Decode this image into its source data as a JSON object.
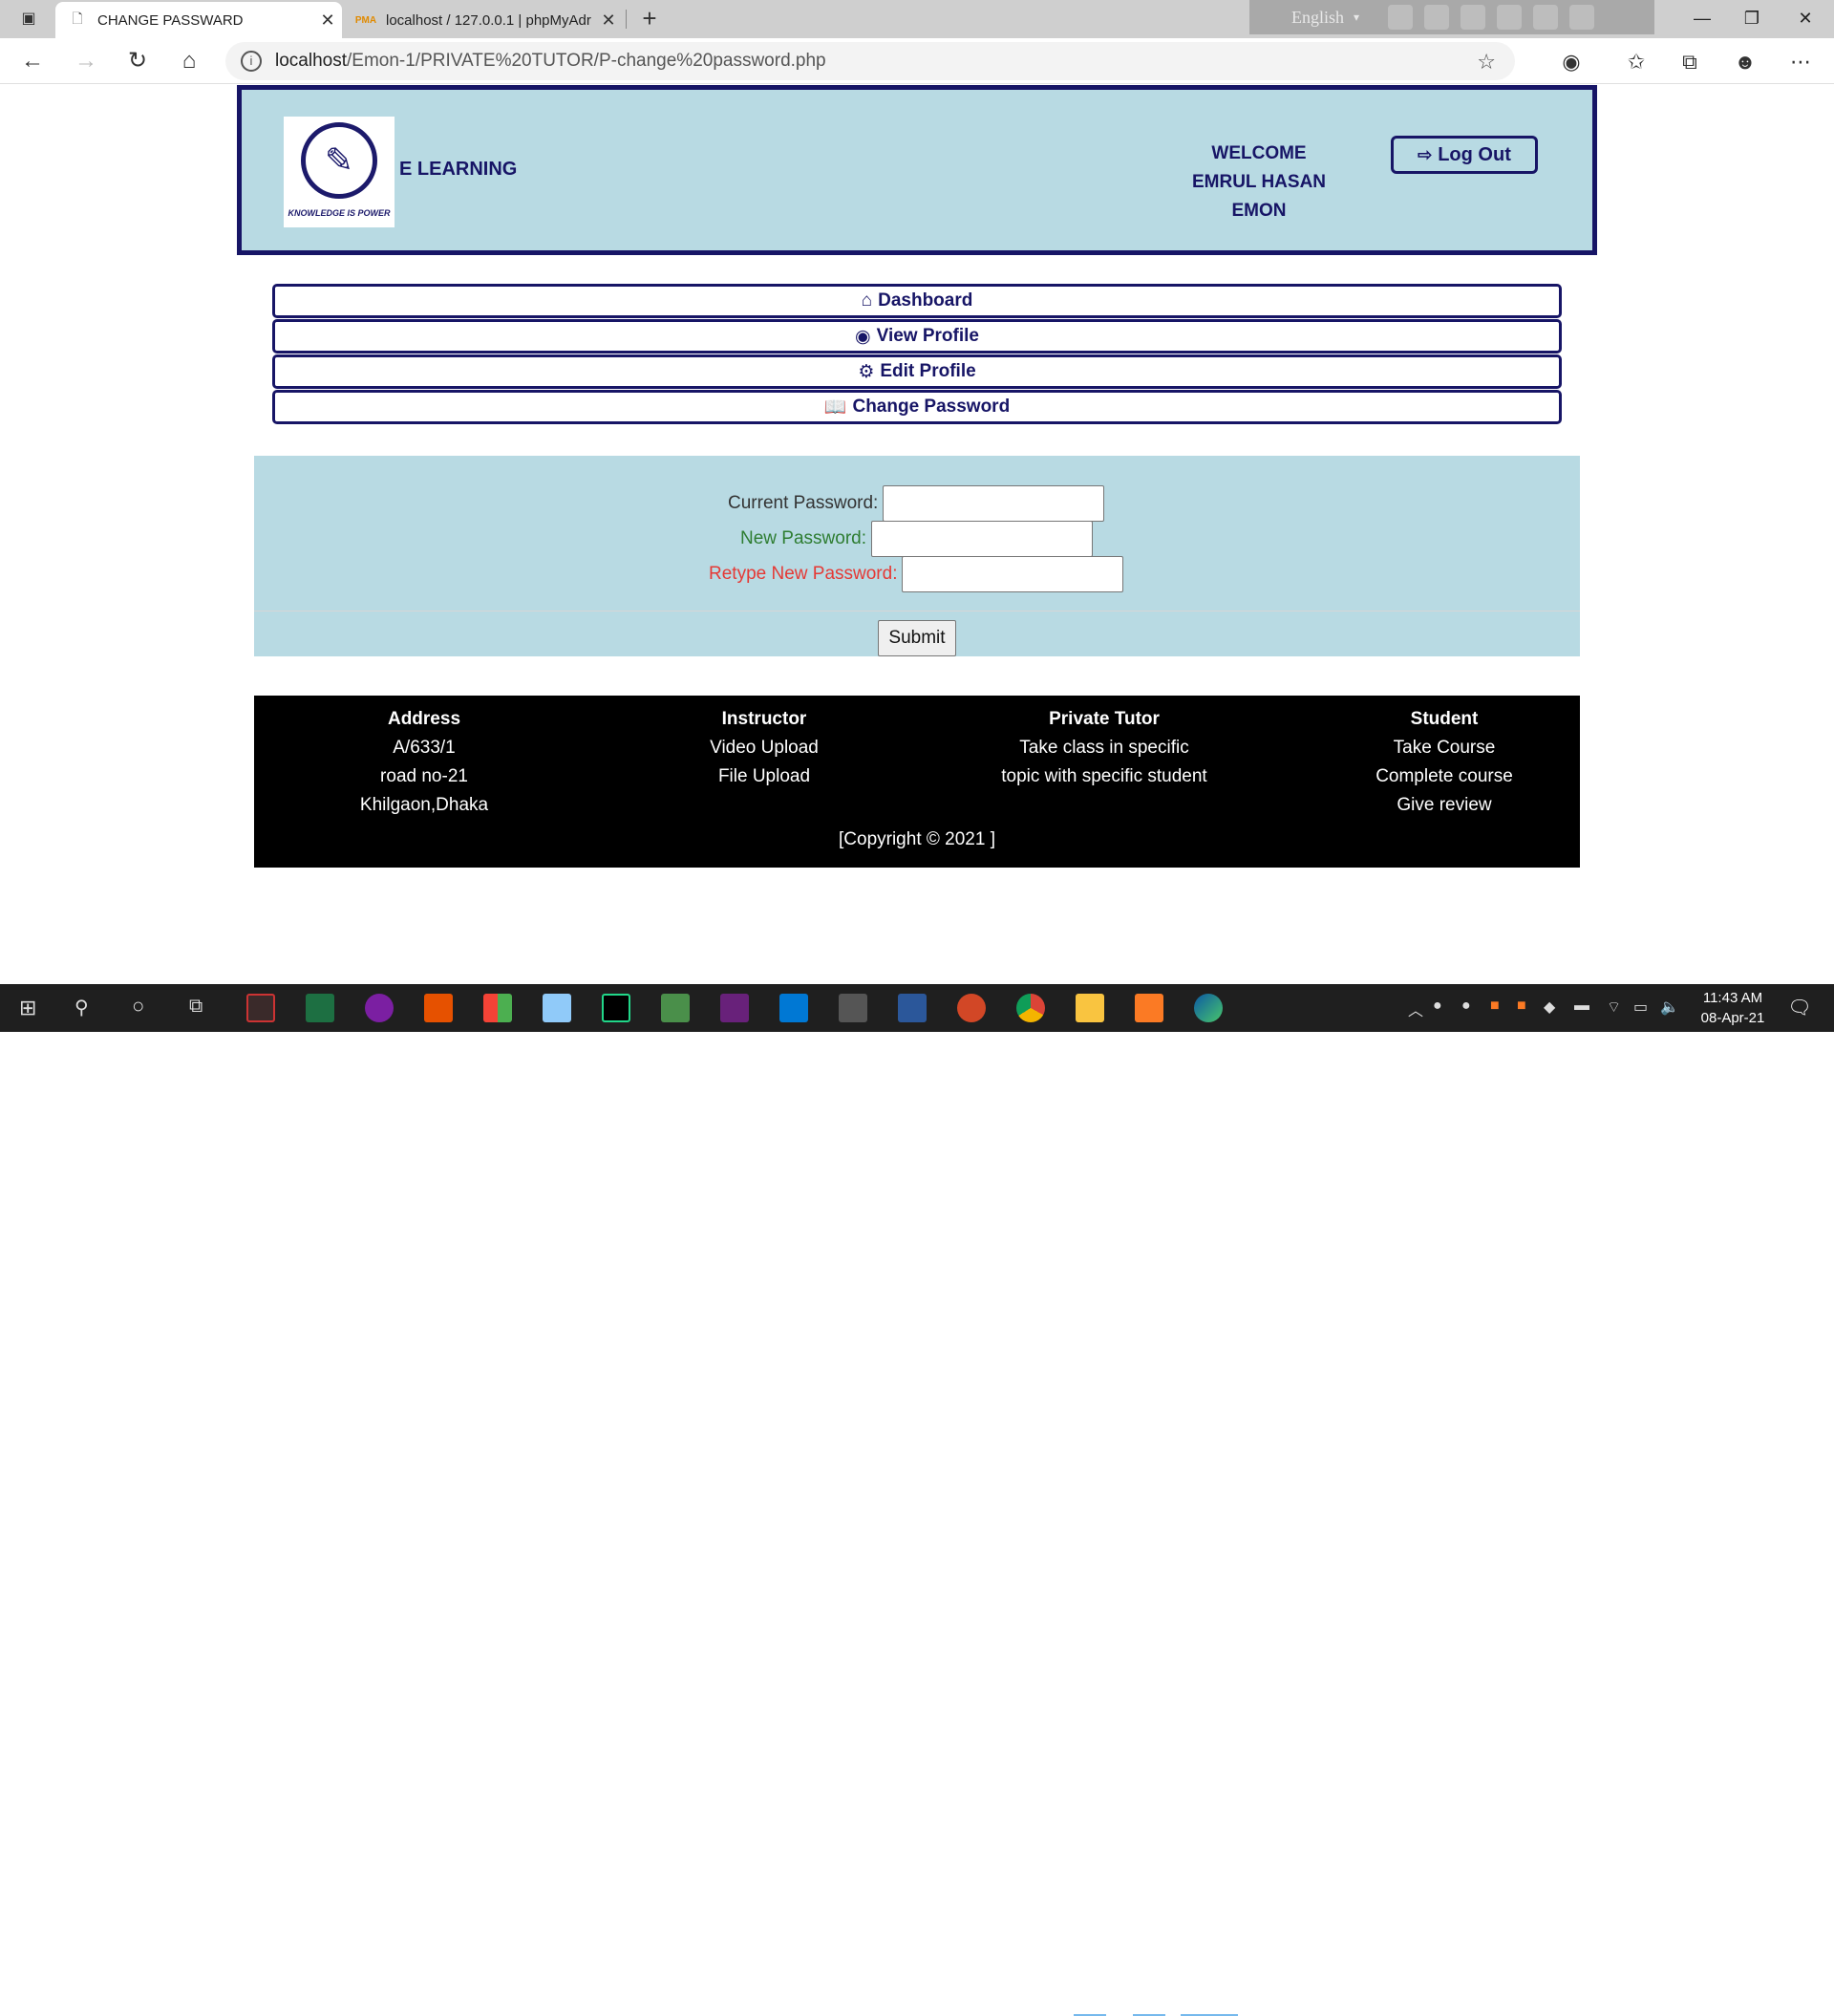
{
  "browser": {
    "tabs": [
      {
        "title": "CHANGE PASSWARD",
        "active": true
      },
      {
        "title": "localhost / 127.0.0.1 | phpMyAdr",
        "active": false
      }
    ],
    "url_host": "localhost",
    "url_path": "/Emon-1/PRIVATE%20TUTOR/P-change%20password.php",
    "language_bar": "English"
  },
  "header": {
    "logo_text": "KNOWLEDGE IS POWER",
    "site_name": "E LEARNING",
    "welcome_lines": [
      "WELCOME",
      "EMRUL HASAN",
      "EMON"
    ],
    "logout_label": "Log Out"
  },
  "menu": [
    {
      "icon": "home-icon",
      "label": "Dashboard"
    },
    {
      "icon": "user-circle-icon",
      "label": "View Profile"
    },
    {
      "icon": "gear-icon",
      "label": "Edit Profile"
    },
    {
      "icon": "book-icon",
      "label": "Change Password"
    }
  ],
  "form": {
    "current_label": "Current Password:",
    "new_label": "New Password:",
    "retype_label": "Retype New Password:",
    "submit_label": "Submit",
    "colors": {
      "current": "#333333",
      "new": "#2e7d32",
      "retype": "#e53935"
    }
  },
  "footer": {
    "columns": [
      {
        "heading": "Address",
        "lines": [
          "A/633/1",
          "road no-21",
          "Khilgaon,Dhaka"
        ]
      },
      {
        "heading": "Instructor",
        "lines": [
          "Video Upload",
          "File Upload"
        ]
      },
      {
        "heading": "Private Tutor",
        "lines": [
          "Take class in specific",
          "topic with specific student"
        ]
      },
      {
        "heading": "Student",
        "lines": [
          "Take Course",
          "Complete course",
          "Give review"
        ]
      }
    ],
    "copyright": "[Copyright © 2021 ]"
  },
  "taskbar": {
    "time": "11:43 AM",
    "date": "08-Apr-21"
  },
  "colors": {
    "accent": "#171566",
    "panel": "#b8dae3"
  }
}
